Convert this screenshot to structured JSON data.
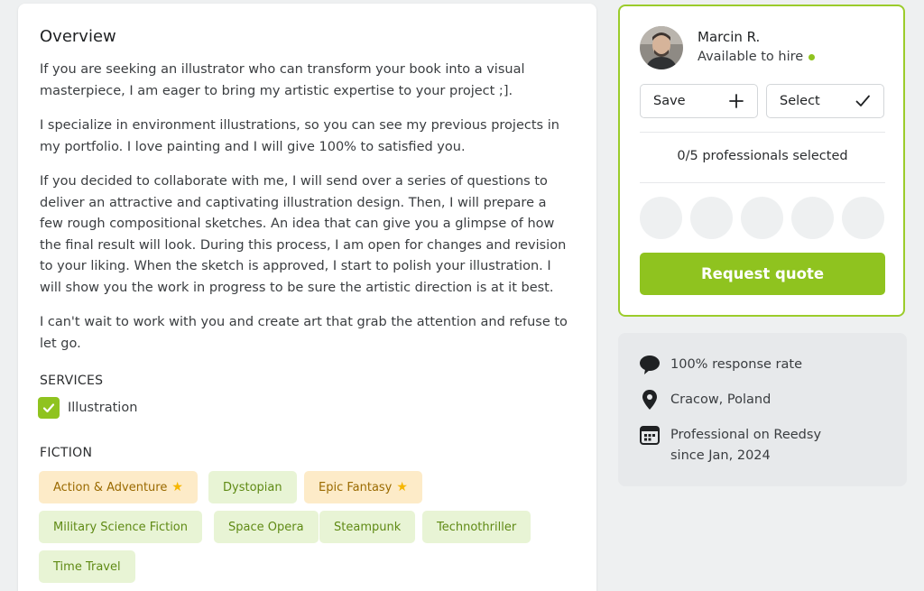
{
  "overview": {
    "title": "Overview",
    "paragraphs": [
      "If you are seeking an illustrator who can transform your book into a visual masterpiece, I am eager to bring my artistic expertise to your project ;].",
      "I specialize in environment illustrations, so you can see my previous projects in my portfolio. I love painting and I will give 100% to satisfied you.",
      "If you decided to collaborate with me, I will send over a series of questions to deliver an attractive and captivating illustration design. Then, I will prepare a few rough compositional sketches. An idea that can give you a glimpse of how the final result will look. During this process, I am open for changes and revision to your liking. When the sketch is approved, I start to polish your illustration. I will show you the work in progress to be sure the artistic direction is at it best.",
      "I can't wait to work with you and create art that grab the attention and refuse to let go."
    ]
  },
  "services": {
    "heading": "SERVICES",
    "items": [
      {
        "label": "Illustration",
        "checked": true
      }
    ]
  },
  "fiction": {
    "heading": "FICTION",
    "tags": [
      {
        "label": "Action & Adventure",
        "starred": true
      },
      {
        "label": "Dystopian",
        "starred": false
      },
      {
        "label": "Epic Fantasy",
        "starred": true
      },
      {
        "label": "Military Science Fiction",
        "starred": false
      },
      {
        "label": "Space Opera",
        "starred": false
      },
      {
        "label": "Steampunk",
        "starred": false
      },
      {
        "label": "Technothriller",
        "starred": false
      },
      {
        "label": "Time Travel",
        "starred": false
      }
    ]
  },
  "profile": {
    "name": "Marcin R.",
    "availability": "Available to hire",
    "save_label": "Save",
    "select_label": "Select",
    "selected_count": "0/5 professionals selected",
    "quote_label": "Request quote"
  },
  "info": {
    "response_rate": "100% response rate",
    "location": "Cracow, Poland",
    "member_line1": "Professional on Reedsy",
    "member_line2": "since Jan, 2024"
  },
  "colors": {
    "accent": "#8fc31f",
    "star_tag_bg": "#fdebc8",
    "green_tag_bg": "#e8f4d5"
  },
  "icons": [
    "check-icon",
    "star-icon",
    "plus-icon",
    "checkmark-icon",
    "speech-bubble-icon",
    "location-pin-icon",
    "calendar-icon"
  ]
}
